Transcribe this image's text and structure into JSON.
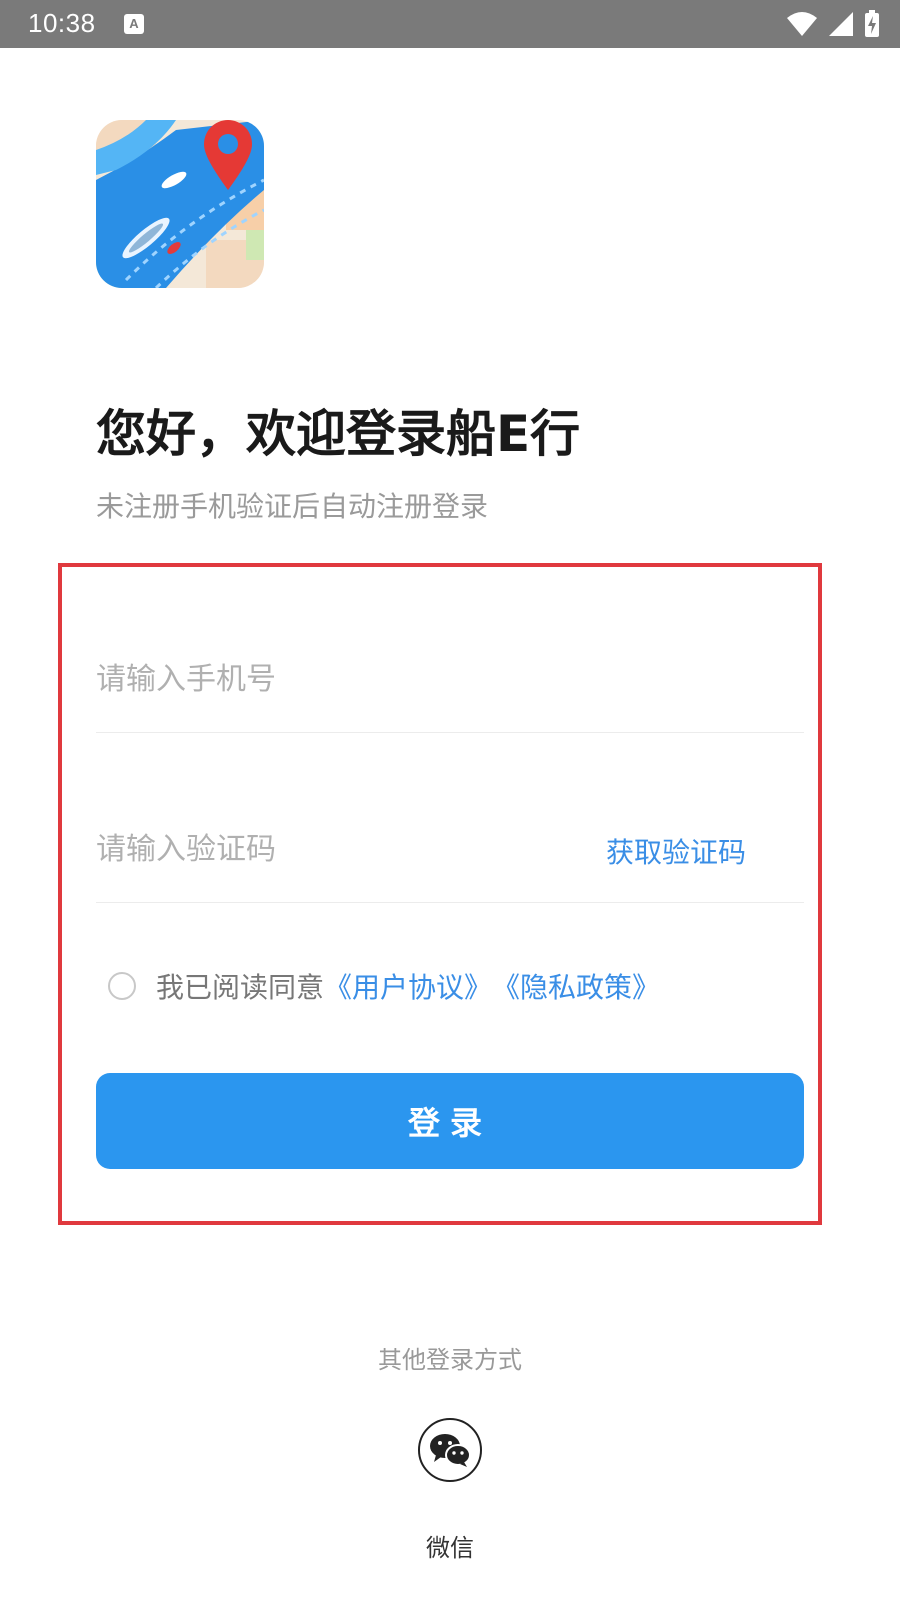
{
  "status_bar": {
    "time": "10:38",
    "notification_icon": "a-icon",
    "icons": [
      "wifi-icon",
      "signal-icon",
      "battery-charging-icon"
    ]
  },
  "app": {
    "logo_icon": "map-ship-location-icon",
    "welcome_title": "您好，欢迎登录船E行",
    "welcome_subtitle": "未注册手机验证后自动注册登录"
  },
  "form": {
    "phone_placeholder": "请输入手机号",
    "phone_value": "",
    "code_placeholder": "请输入验证码",
    "code_value": "",
    "get_code_label": "获取验证码",
    "agree_checked": false,
    "agree_text": "我已阅读同意",
    "user_agreement_link": "《用户协议》",
    "privacy_policy_link": "《隐私政策》",
    "login_label": "登录"
  },
  "other_login": {
    "title": "其他登录方式",
    "wechat_label": "微信",
    "wechat_icon": "wechat-icon"
  },
  "colors": {
    "accent": "#2b96ef",
    "link": "#3a8ee6",
    "highlight_border": "#e0393e",
    "status_bar": "#7a7a7a"
  }
}
